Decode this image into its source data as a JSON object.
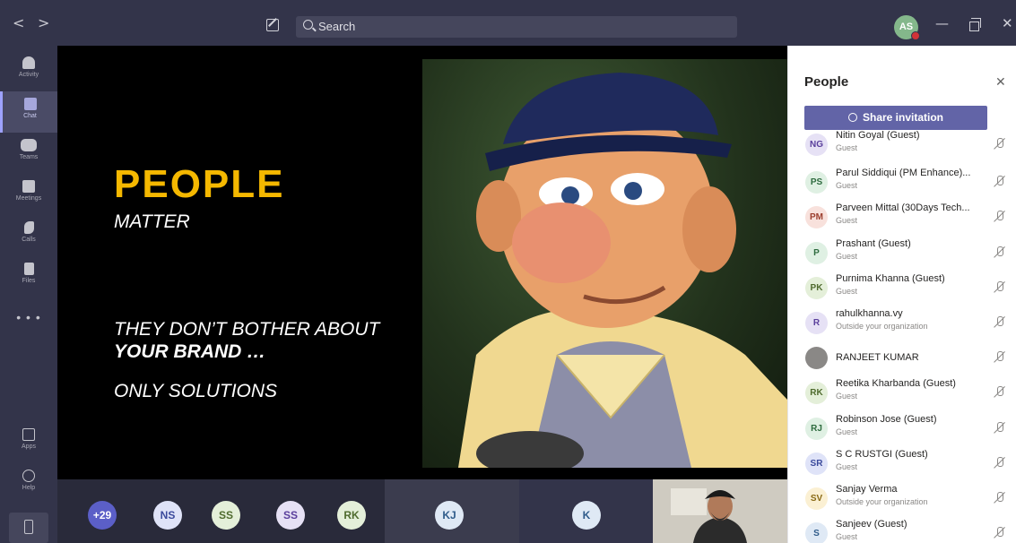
{
  "titlebar": {
    "back": "<",
    "forward": ">",
    "search_placeholder": "Search",
    "user_initials": "AS",
    "minimize": "—",
    "close": "✕"
  },
  "rail": {
    "items": [
      {
        "label": "Activity",
        "icon": "bell-icon"
      },
      {
        "label": "Chat",
        "icon": "chat-icon"
      },
      {
        "label": "Teams",
        "icon": "teams-icon"
      },
      {
        "label": "Meetings",
        "icon": "calendar-icon"
      },
      {
        "label": "Calls",
        "icon": "phone-icon"
      },
      {
        "label": "Files",
        "icon": "file-icon"
      }
    ],
    "more": "• • •",
    "apps": "Apps",
    "help": "Help"
  },
  "slide": {
    "title": "PEOPLE",
    "subtitle": "MATTER",
    "line1": "THEY DON’T BOTHER ABOUT",
    "line2": "YOUR BRAND …",
    "line3": "ONLY SOLUTIONS"
  },
  "strip": {
    "participants": [
      {
        "initials": "+29",
        "bg": "#5b5fc7",
        "fg": "#ffffff"
      },
      {
        "initials": "NS",
        "bg": "#dfe3f8",
        "fg": "#3b4a9c"
      },
      {
        "initials": "SS",
        "bg": "#e4efd9",
        "fg": "#4f6b2e"
      },
      {
        "initials": "SS",
        "bg": "#e6e1f5",
        "fg": "#5a3f9c"
      },
      {
        "initials": "RK",
        "bg": "#e4efd9",
        "fg": "#4f6b2e"
      },
      {
        "initials": "KJ",
        "bg": "#dfe9f5",
        "fg": "#2f5b8a"
      },
      {
        "initials": "K",
        "bg": "#dfe9f5",
        "fg": "#2f5b8a"
      }
    ]
  },
  "panel": {
    "title": "People",
    "close": "✕",
    "share_label": "Share invitation",
    "people": [
      {
        "initials": "NG",
        "name": "Nitin Goyal (Guest)",
        "role": "Guest",
        "bg": "#e6e1f5",
        "fg": "#5a3f9c"
      },
      {
        "initials": "PS",
        "name": "Parul Siddiqui (PM Enhance)...",
        "role": "Guest",
        "bg": "#dff0e3",
        "fg": "#2e6b3f"
      },
      {
        "initials": "PM",
        "name": "Parveen Mittal (30Days Tech...",
        "role": "Guest",
        "bg": "#f8e1dc",
        "fg": "#9c3f2f"
      },
      {
        "initials": "P",
        "name": "Prashant (Guest)",
        "role": "Guest",
        "bg": "#dff0e3",
        "fg": "#2e6b3f"
      },
      {
        "initials": "PK",
        "name": "Purnima Khanna (Guest)",
        "role": "Guest",
        "bg": "#e4efd9",
        "fg": "#4f6b2e"
      },
      {
        "initials": "R",
        "name": "rahulkhanna.vy",
        "role": "Outside your organization",
        "bg": "#e6e1f5",
        "fg": "#5a3f9c"
      },
      {
        "initials": "",
        "name": "RANJEET KUMAR",
        "role": "",
        "bg": "#8a8886",
        "fg": "#ffffff"
      },
      {
        "initials": "RK",
        "name": "Reetika Kharbanda (Guest)",
        "role": "Guest",
        "bg": "#e4efd9",
        "fg": "#4f6b2e"
      },
      {
        "initials": "RJ",
        "name": "Robinson Jose (Guest)",
        "role": "Guest",
        "bg": "#dff0e3",
        "fg": "#2e6b3f"
      },
      {
        "initials": "SR",
        "name": "S C RUSTGI (Guest)",
        "role": "Guest",
        "bg": "#dfe3f8",
        "fg": "#3b4a9c"
      },
      {
        "initials": "SV",
        "name": "Sanjay Verma",
        "role": "Outside your organization",
        "bg": "#fbf0d3",
        "fg": "#8a6a14"
      },
      {
        "initials": "S",
        "name": "Sanjeev (Guest)",
        "role": "Guest",
        "bg": "#dfe9f5",
        "fg": "#2f5b8a"
      }
    ]
  }
}
